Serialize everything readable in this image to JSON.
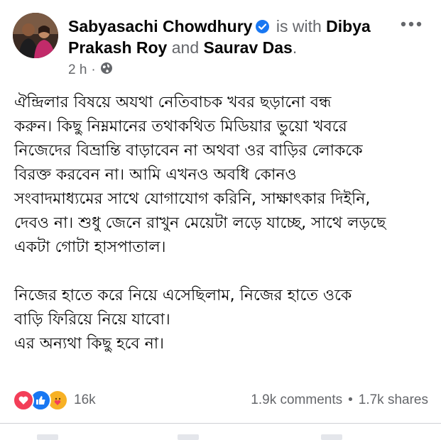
{
  "post": {
    "author": "Sabyasachi Chowdhury",
    "with_text": "is with",
    "tagged_1": "Dibya Prakash Roy",
    "and_text": "and",
    "tagged_2": "Saurav Das",
    "period": ".",
    "time": "2 h",
    "dot": "·",
    "privacy_icon": "globe-icon",
    "verified_icon": "verified-badge-icon",
    "menu_icon": "more-options-icon",
    "paragraph_1": "ঐন্দ্রিলার বিষয়ে অযথা নেতিবাচক খবর ছড়ানো বন্ধ\nকরুন। কিছু নিম্নমানের তথাকথিত মিডিয়ার ভুয়ো খবরে\nনিজেদের বিভ্রান্তি বাড়াবেন না অথবা ওর বাড়ির লোককে\nবিরক্ত করবেন না। আমি এখনও অবধি কোনও\nসংবাদমাধ্যমের সাথে যোগাযোগ করিনি, সাক্ষাৎকার দিইনি,\nদেবও না। শুধু জেনে রাখুন মেয়েটা লড়ে যাচ্ছে, সাথে লড়ছে\nএকটা গোটা হাসপাতাল।",
    "paragraph_2": "নিজের হাতে করে নিয়ে এসেছিলাম, নিজের হাতে ওকে\nবাড়ি ফিরিয়ে নিয়ে যাবো।\nএর অন্যথা কিছু হবে না।"
  },
  "engagement": {
    "reactions": [
      "love-icon",
      "like-icon",
      "care-icon"
    ],
    "reaction_count": "16k",
    "comments": "1.9k comments",
    "separator": "•",
    "shares": "1.7k shares"
  },
  "colors": {
    "text": "#050505",
    "secondary": "#65676b",
    "brand_blue": "#1877f2",
    "love_red": "#f33e58",
    "care_yellow": "#f7b125"
  }
}
